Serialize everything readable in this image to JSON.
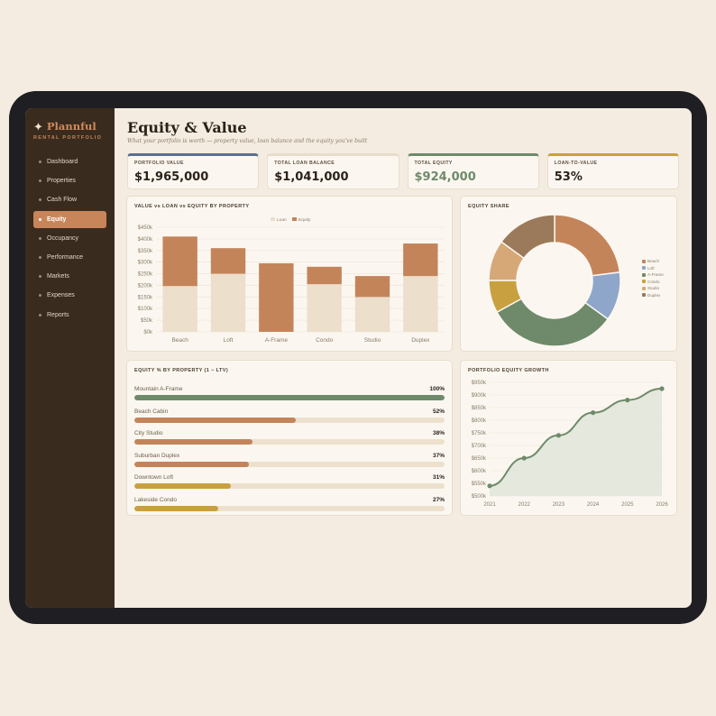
{
  "brand": {
    "name": "Plannful",
    "sub": "RENTAL PORTFOLIO"
  },
  "nav": [
    {
      "label": "Dashboard",
      "active": false
    },
    {
      "label": "Properties",
      "active": false
    },
    {
      "label": "Cash Flow",
      "active": false
    },
    {
      "label": "Equity",
      "active": true
    },
    {
      "label": "Occupancy",
      "active": false
    },
    {
      "label": "Performance",
      "active": false
    },
    {
      "label": "Markets",
      "active": false
    },
    {
      "label": "Expenses",
      "active": false
    },
    {
      "label": "Reports",
      "active": false
    }
  ],
  "page": {
    "title": "Equity & Value",
    "subtitle": "What your portfolio is worth — property value, loan balance and the equity you've built"
  },
  "kpis": [
    {
      "label": "PORTFOLIO VALUE",
      "value": "$1,965,000",
      "accent": "#5b6f8f",
      "value_color": "#2b2118"
    },
    {
      "label": "TOTAL LOAN BALANCE",
      "value": "$1,041,000",
      "accent": "#e8ddcc",
      "value_color": "#2b2118"
    },
    {
      "label": "TOTAL EQUITY",
      "value": "$924,000",
      "accent": "#6e8a6a",
      "value_color": "#6e8a6a"
    },
    {
      "label": "LOAN-TO-VALUE",
      "value": "53%",
      "accent": "#c9a040",
      "value_color": "#2b2118"
    }
  ],
  "cards": {
    "value_chart": "VALUE vs LOAN vs EQUITY BY PROPERTY",
    "equity_share": "EQUITY SHARE",
    "equity_pct": "EQUITY % BY PROPERTY (1 − LTV)",
    "growth": "PORTFOLIO EQUITY GROWTH"
  },
  "equity_pct": [
    {
      "name": "Mountain A-Frame",
      "pct": 100,
      "label": "100%",
      "color": "#6e8a6a"
    },
    {
      "name": "Beach Cabin",
      "pct": 52,
      "label": "52%",
      "color": "#c4845a"
    },
    {
      "name": "City Studio",
      "pct": 38,
      "label": "38%",
      "color": "#c4845a"
    },
    {
      "name": "Suburban Duplex",
      "pct": 37,
      "label": "37%",
      "color": "#c4845a"
    },
    {
      "name": "Downtown Loft",
      "pct": 31,
      "label": "31%",
      "color": "#c9a040"
    },
    {
      "name": "Lakeside Condo",
      "pct": 27,
      "label": "27%",
      "color": "#c9a040"
    }
  ],
  "chart_data": [
    {
      "type": "bar",
      "stacked": true,
      "title": "VALUE vs LOAN vs EQUITY BY PROPERTY",
      "categories": [
        "Beach",
        "Loft",
        "A-Frame",
        "Condo",
        "Studio",
        "Duplex"
      ],
      "series": [
        {
          "name": "Loan",
          "color": "#ecdfcb",
          "values": [
            197,
            250,
            0,
            205,
            150,
            240
          ]
        },
        {
          "name": "Equity",
          "color": "#c4845a",
          "values": [
            213,
            110,
            295,
            75,
            90,
            140
          ]
        }
      ],
      "ylim": [
        0,
        450
      ],
      "yticks": [
        "$0k",
        "$50k",
        "$100k",
        "$150k",
        "$200k",
        "$250k",
        "$300k",
        "$350k",
        "$400k",
        "$450k"
      ],
      "legend": "top-center",
      "grid": true
    },
    {
      "type": "pie",
      "donut": true,
      "title": "EQUITY SHARE",
      "slices": [
        {
          "name": "Beach",
          "value": 23,
          "color": "#c4845a"
        },
        {
          "name": "Loft",
          "value": 12,
          "color": "#8ea6c9"
        },
        {
          "name": "A-Frame",
          "value": 32,
          "color": "#6e8a6a"
        },
        {
          "name": "Condo",
          "value": 8,
          "color": "#c9a040"
        },
        {
          "name": "Studio",
          "value": 10,
          "color": "#d6a878"
        },
        {
          "name": "Duplex",
          "value": 15,
          "color": "#9a7a5a"
        }
      ],
      "legend": "right"
    },
    {
      "type": "area",
      "title": "PORTFOLIO EQUITY GROWTH",
      "x": [
        "2021",
        "2022",
        "2023",
        "2024",
        "2025",
        "2026"
      ],
      "values": [
        540,
        650,
        740,
        830,
        880,
        925
      ],
      "ylim": [
        500,
        950
      ],
      "yticks": [
        "$500k",
        "$550k",
        "$600k",
        "$650k",
        "$700k",
        "$750k",
        "$800k",
        "$850k",
        "$900k",
        "$950k"
      ],
      "color": "#6e8a6a",
      "grid": true
    }
  ]
}
